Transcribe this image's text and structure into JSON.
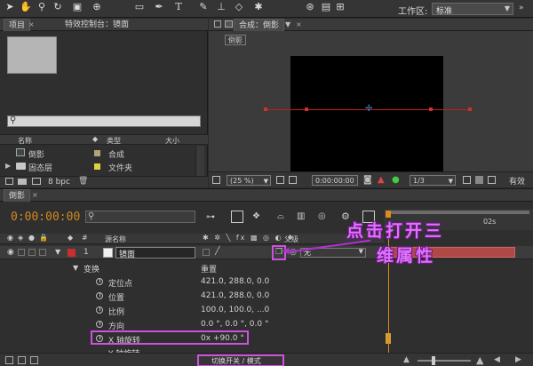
{
  "toolbar": {
    "workspace_label": "工作区:",
    "workspace_value": "标准",
    "tools": [
      "select-arrow",
      "hand",
      "zoom",
      "rotate",
      "camera",
      "pan-behind",
      "rectangle",
      "pen",
      "type",
      "brush",
      "clone-stamp",
      "eraser",
      "puppet"
    ]
  },
  "project_panel": {
    "tab_project": "项目",
    "tab_effects": "特效控制台：镜面",
    "columns": {
      "name": "名称",
      "type": "类型",
      "size": "大小"
    },
    "items": [
      {
        "name": "倒影",
        "type": "合成",
        "color": "#b0a27a"
      },
      {
        "name": "固态层",
        "type": "文件夹",
        "color": "#e0d040"
      }
    ],
    "bpc": "8 bpc"
  },
  "composition_panel": {
    "tab_label": "合成：倒影",
    "sub_tab": "倒影",
    "zoom": "(25 %)",
    "timecode": "0:00:00:00",
    "resolution": "1/3",
    "extra": "有效"
  },
  "timeline": {
    "tab_label": "倒影",
    "timecode": "0:00:00:00",
    "col_source_name": "源名称",
    "col_parent": "父级",
    "layer_number": "1",
    "layer_name": "镜面",
    "layer_color": "#c83030",
    "parent_value": "无",
    "group_transform": "变换",
    "reset_label": "重置",
    "properties": [
      {
        "name": "定位点",
        "value": "421.0, 288.0, 0.0"
      },
      {
        "name": "位置",
        "value": "421.0, 288.0, 0.0"
      },
      {
        "name": "比例",
        "value": "100.0, 100.0, ...0"
      },
      {
        "name": "方向",
        "value": "0.0 °, 0.0 °, 0.0 °"
      },
      {
        "name": "X 轴旋转",
        "value": "0x +90.0 °"
      },
      {
        "name": "Y 轴旋转",
        "value": ""
      }
    ],
    "ruler_tick": "02s",
    "toggle_label": "切换开关 / 模式"
  },
  "annotation": {
    "line1": "点击打开三",
    "line2": "维属性"
  }
}
